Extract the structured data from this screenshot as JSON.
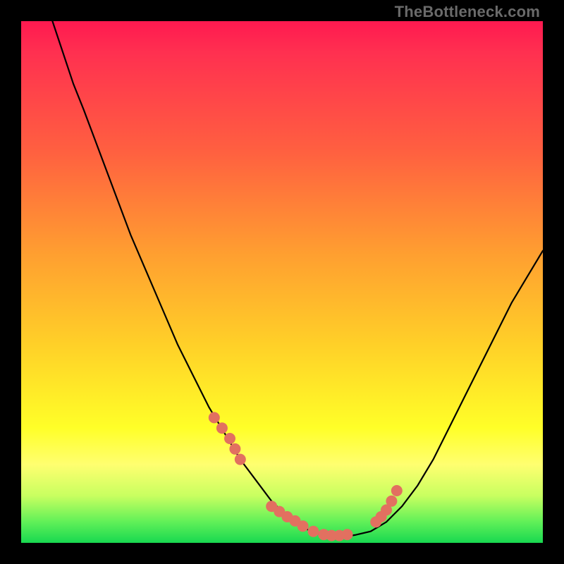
{
  "watermark": "TheBottleneck.com",
  "colors": {
    "background_black": "#000000",
    "gradient_top": "#ff1950",
    "gradient_mid": "#ffd028",
    "gradient_bottom": "#18d850",
    "curve_stroke": "#000000",
    "dot_fill": "#e27060"
  },
  "chart_data": {
    "type": "line",
    "title": "",
    "xlabel": "",
    "ylabel": "",
    "xlim": [
      0,
      100
    ],
    "ylim": [
      0,
      100
    ],
    "grid": false,
    "legend": false,
    "x": [
      6,
      8,
      10,
      12,
      15,
      18,
      21,
      24,
      27,
      30,
      33,
      36,
      39,
      42,
      45,
      48,
      51,
      54,
      56,
      58,
      60,
      62,
      64,
      67,
      70,
      73,
      76,
      79,
      82,
      85,
      88,
      91,
      94,
      97,
      100
    ],
    "y": [
      100,
      94,
      88,
      83,
      75,
      67,
      59,
      52,
      45,
      38,
      32,
      26,
      21,
      16,
      12,
      8,
      5,
      3,
      2,
      1.5,
      1.2,
      1.2,
      1.5,
      2.2,
      4,
      7,
      11,
      16,
      22,
      28,
      34,
      40,
      46,
      51,
      56
    ],
    "scatter_overlay": {
      "x": [
        37,
        38.5,
        40,
        41,
        42,
        48,
        49.5,
        51,
        52.5,
        54,
        56,
        58,
        59.5,
        61,
        62.5,
        68,
        69,
        70,
        71,
        72
      ],
      "y": [
        24,
        22,
        20,
        18,
        16,
        7,
        6,
        5,
        4.2,
        3.2,
        2.2,
        1.6,
        1.4,
        1.4,
        1.6,
        4,
        5,
        6.3,
        8,
        10
      ],
      "marker_radius": 8
    }
  }
}
